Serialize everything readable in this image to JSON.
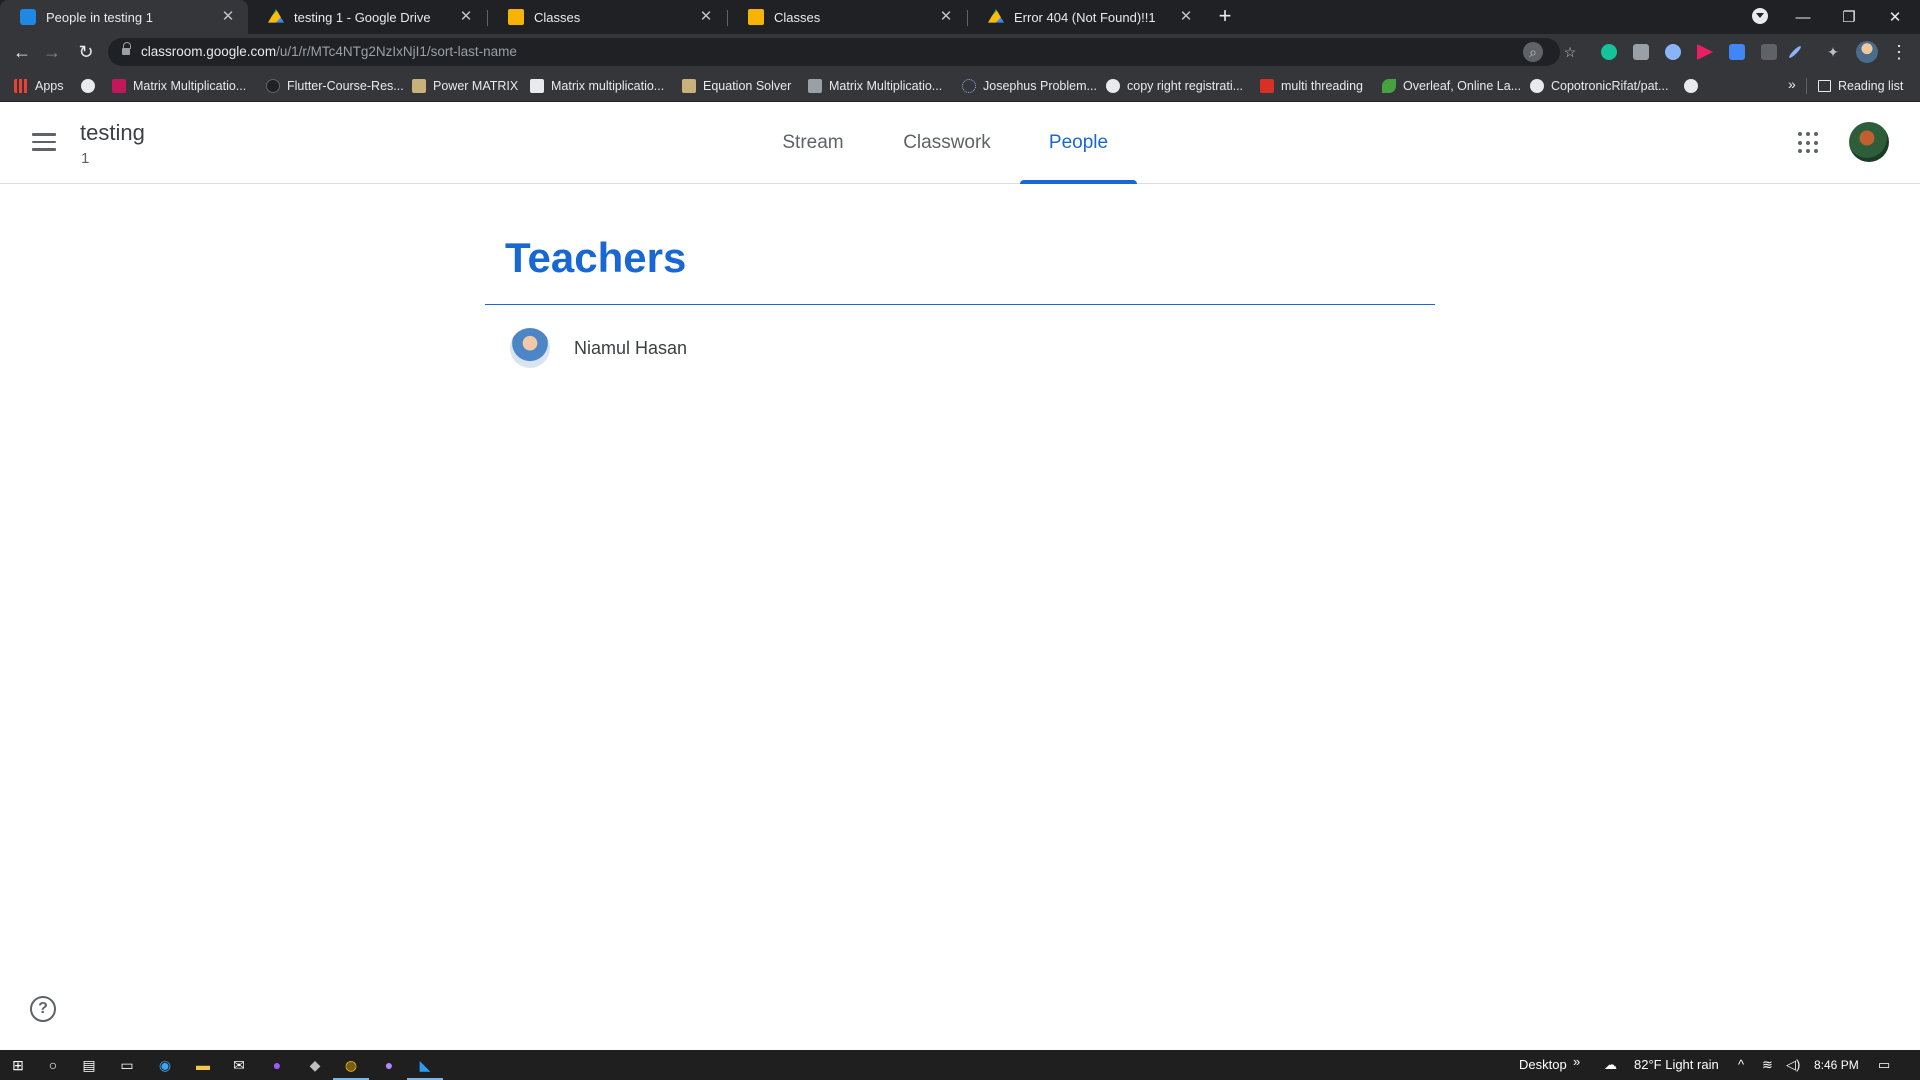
{
  "browser": {
    "tabs": [
      {
        "title": "People in testing 1",
        "favicon": "classroom-icon",
        "active": true
      },
      {
        "title": "testing 1 - Google Drive",
        "favicon": "drive-icon",
        "active": false
      },
      {
        "title": "Classes",
        "favicon": "classroom-yellow-icon",
        "active": false
      },
      {
        "title": "Classes",
        "favicon": "classroom-yellow-icon",
        "active": false
      },
      {
        "title": "Error 404 (Not Found)!!1",
        "favicon": "drive-icon",
        "active": false
      }
    ],
    "url_host": "classroom.google.com",
    "url_path": "/u/1/r/MTc4NTg2NzIxNjI1/sort-last-name",
    "bookmarks": [
      {
        "label": "Apps",
        "icon": "apps-grid-icon",
        "color": "#ea4335"
      },
      {
        "label": "",
        "icon": "globe-icon",
        "color": "#e8eaed"
      },
      {
        "label": "Matrix Multiplicatio...",
        "icon": "matrix-icon",
        "color": "#c2185b"
      },
      {
        "label": "Flutter-Course-Res...",
        "icon": "github-icon",
        "color": "#202124"
      },
      {
        "label": "Power MATRIX",
        "icon": "doc-icon",
        "color": "#c9b27a"
      },
      {
        "label": "Matrix multiplicatio...",
        "icon": "math-icon",
        "color": "#e8eaed"
      },
      {
        "label": "Equation Solver",
        "icon": "doc-icon",
        "color": "#c9b27a"
      },
      {
        "label": "Matrix Multiplicatio...",
        "icon": "r-icon",
        "color": "#9aa0a6"
      },
      {
        "label": "Josephus Problem...",
        "icon": "loading-icon",
        "color": "#5f6368"
      },
      {
        "label": "copy right registrati...",
        "icon": "globe-icon",
        "color": "#e8eaed"
      },
      {
        "label": "multi threading",
        "icon": "td-icon",
        "color": "#d93025"
      },
      {
        "label": "Overleaf, Online La...",
        "icon": "overleaf-icon",
        "color": "#47a141"
      },
      {
        "label": "CopotronicRifat/pat...",
        "icon": "github-icon",
        "color": "#e8eaed"
      },
      {
        "label": "",
        "icon": "globe-icon",
        "color": "#e8eaed"
      }
    ],
    "reading_list": "Reading list",
    "overflow": "»"
  },
  "classroom": {
    "class_name": "testing",
    "section": "1",
    "tabs": [
      {
        "label": "Stream",
        "active": false
      },
      {
        "label": "Classwork",
        "active": false
      },
      {
        "label": "People",
        "active": true
      }
    ],
    "accent_color": "#1967d2"
  },
  "people": {
    "teachers_heading": "Teachers",
    "teachers": [
      {
        "name": "Niamul Hasan"
      }
    ]
  },
  "help": {
    "symbol": "?"
  },
  "taskbar": {
    "desktop_label": "Desktop",
    "weather": "82°F  Light rain",
    "time": "8:46 PM"
  }
}
